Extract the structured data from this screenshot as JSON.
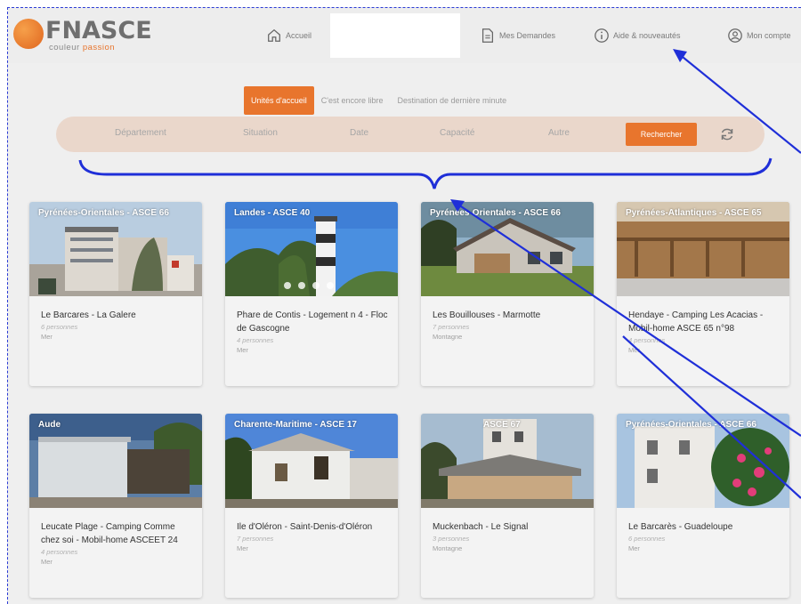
{
  "brand": {
    "name": "FNASCE",
    "tagline_1": "couleur",
    "tagline_2": "passion",
    "accent": "#e8752d"
  },
  "nav": [
    {
      "icon": "home-icon",
      "label": "Accueil"
    },
    {
      "icon": "document-icon",
      "label": "Mes Demandes"
    },
    {
      "icon": "info-icon",
      "label": "Aide & nouveautés"
    },
    {
      "icon": "user-icon",
      "label": "Mon compte"
    }
  ],
  "tabs": [
    {
      "label": "Unités d'accueil",
      "active": true
    },
    {
      "label": "C'est encore libre",
      "active": false
    },
    {
      "label": "Destination de dernière minute",
      "active": false
    }
  ],
  "filters": [
    "Département",
    "Situation",
    "Date",
    "Capacité",
    "Autre"
  ],
  "search_label": "Rechercher",
  "cards": [
    {
      "region": "Pyrénées-Orientales - ASCE 66",
      "title": "Le Barcares - La Galere",
      "capacity": "6 personnes",
      "type": "Mer"
    },
    {
      "region": "Landes - ASCE 40",
      "title": "Phare de Contis - Logement n 4 - Floc de Gascogne",
      "capacity": "4 personnes",
      "type": "Mer"
    },
    {
      "region": "Pyrénées-Orientales - ASCE 66",
      "title": "Les Bouillouses - Marmotte",
      "capacity": "7 personnes",
      "type": "Montagne"
    },
    {
      "region": "Pyrénées-Atlantiques - ASCE 65",
      "title": "Hendaye - Camping Les Acacias - Mobil-home ASCE 65 n°98",
      "capacity": "4 personnes",
      "type": "Mer"
    },
    {
      "region": "Aude",
      "title": "Leucate Plage - Camping Comme chez soi - Mobil-home ASCEET 24",
      "capacity": "4 personnes",
      "type": "Mer"
    },
    {
      "region": "Charente-Maritime - ASCE 17",
      "title": "Ile d'Oléron - Saint-Denis-d'Oléron",
      "capacity": "7 personnes",
      "type": "Mer"
    },
    {
      "region": "ASCE 67",
      "title": "Muckenbach - Le Signal",
      "capacity": "3 personnes",
      "type": "Montagne"
    },
    {
      "region": "Pyrénées-Orientales - ASCE 66",
      "title": "Le Barcarès - Guadeloupe",
      "capacity": "6 personnes",
      "type": "Mer"
    }
  ],
  "colors": {
    "annotation": "#1f2fd8",
    "filter_bar": "#ead7cb",
    "page_bg": "#efefef"
  }
}
